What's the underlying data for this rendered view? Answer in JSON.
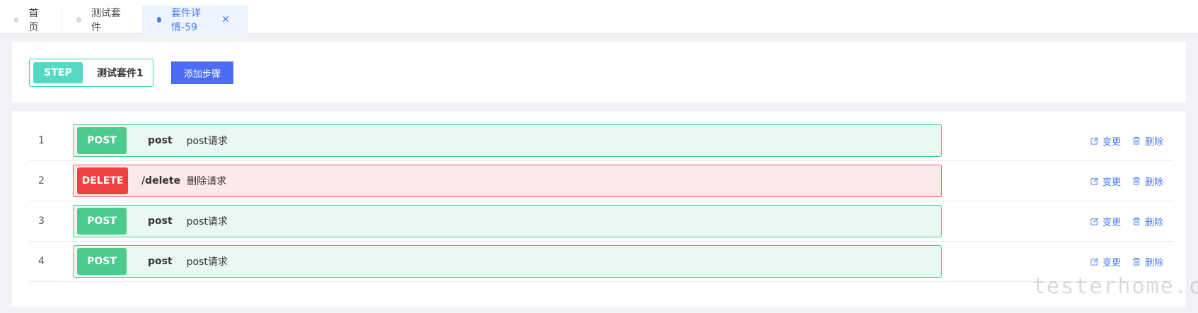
{
  "tabs": [
    {
      "label": "首页",
      "active": false
    },
    {
      "label": "测试套件",
      "active": false
    },
    {
      "label": "套件详情-59",
      "active": true
    }
  ],
  "header": {
    "step_tag": "STEP",
    "step_name": "测试套件1",
    "add_button": "添加步骤"
  },
  "steps": [
    {
      "index": "1",
      "method": "POST",
      "path": "post",
      "desc": "post请求",
      "edit": "变更",
      "delete": "删除"
    },
    {
      "index": "2",
      "method": "DELETE",
      "path": "/delete",
      "desc": "删除请求",
      "edit": "变更",
      "delete": "删除"
    },
    {
      "index": "3",
      "method": "POST",
      "path": "post",
      "desc": "post请求",
      "edit": "变更",
      "delete": "删除"
    },
    {
      "index": "4",
      "method": "POST",
      "path": "post",
      "desc": "post请求",
      "edit": "变更",
      "delete": "删除"
    }
  ],
  "watermark": "testerhome.com",
  "colors": {
    "accent": "#4a7cf0",
    "button": "#4a6cf7",
    "post": "#4bcb8c",
    "delete": "#f04040",
    "step": "#57d8c2"
  },
  "icons": {
    "edit": "edit-icon",
    "delete": "trash-icon",
    "close": "close-icon"
  }
}
